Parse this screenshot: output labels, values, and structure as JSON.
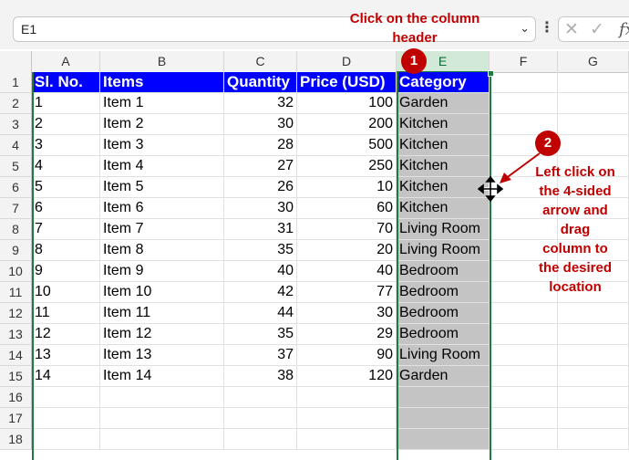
{
  "formula_bar": {
    "name_box": "E1",
    "fx": "fx"
  },
  "columns": [
    "A",
    "B",
    "C",
    "D",
    "E",
    "F",
    "G"
  ],
  "rows": [
    "1",
    "2",
    "3",
    "4",
    "5",
    "6",
    "7",
    "8",
    "9",
    "10",
    "11",
    "12",
    "13",
    "14",
    "15",
    "16",
    "17",
    "18"
  ],
  "table": {
    "headers": [
      "Sl. No.",
      "Items",
      "Quantity",
      "Price (USD)",
      "Category"
    ],
    "data": [
      [
        "1",
        "Item 1",
        "32",
        "100",
        "Garden"
      ],
      [
        "2",
        "Item 2",
        "30",
        "200",
        "Kitchen"
      ],
      [
        "3",
        "Item 3",
        "28",
        "500",
        "Kitchen"
      ],
      [
        "4",
        "Item 4",
        "27",
        "250",
        "Kitchen"
      ],
      [
        "5",
        "Item 5",
        "26",
        "10",
        "Kitchen"
      ],
      [
        "6",
        "Item 6",
        "30",
        "60",
        "Kitchen"
      ],
      [
        "7",
        "Item 7",
        "31",
        "70",
        "Living Room"
      ],
      [
        "8",
        "Item 8",
        "35",
        "20",
        "Living Room"
      ],
      [
        "9",
        "Item 9",
        "40",
        "40",
        "Bedroom"
      ],
      [
        "10",
        "Item 10",
        "42",
        "77",
        "Bedroom"
      ],
      [
        "11",
        "Item 11",
        "44",
        "30",
        "Bedroom"
      ],
      [
        "12",
        "Item 12",
        "35",
        "29",
        "Bedroom"
      ],
      [
        "13",
        "Item 13",
        "37",
        "90",
        "Living Room"
      ],
      [
        "14",
        "Item 14",
        "38",
        "120",
        "Garden"
      ]
    ]
  },
  "annotations": {
    "step1_badge": "1",
    "step1_text_line1": "Click on the column",
    "step1_text_line2": "header",
    "step2_badge": "2",
    "step2_lines": [
      "Left click on",
      "the 4-sided",
      "arrow and",
      "drag",
      "column to",
      "the desired",
      "location"
    ]
  },
  "colors": {
    "header_fill": "#0000ff",
    "selection_fill": "#c4c4c4",
    "selection_border": "#1e7a41",
    "annotation": "#c00000"
  },
  "icons": {
    "move_cursor": "four-sided-arrow-icon"
  }
}
